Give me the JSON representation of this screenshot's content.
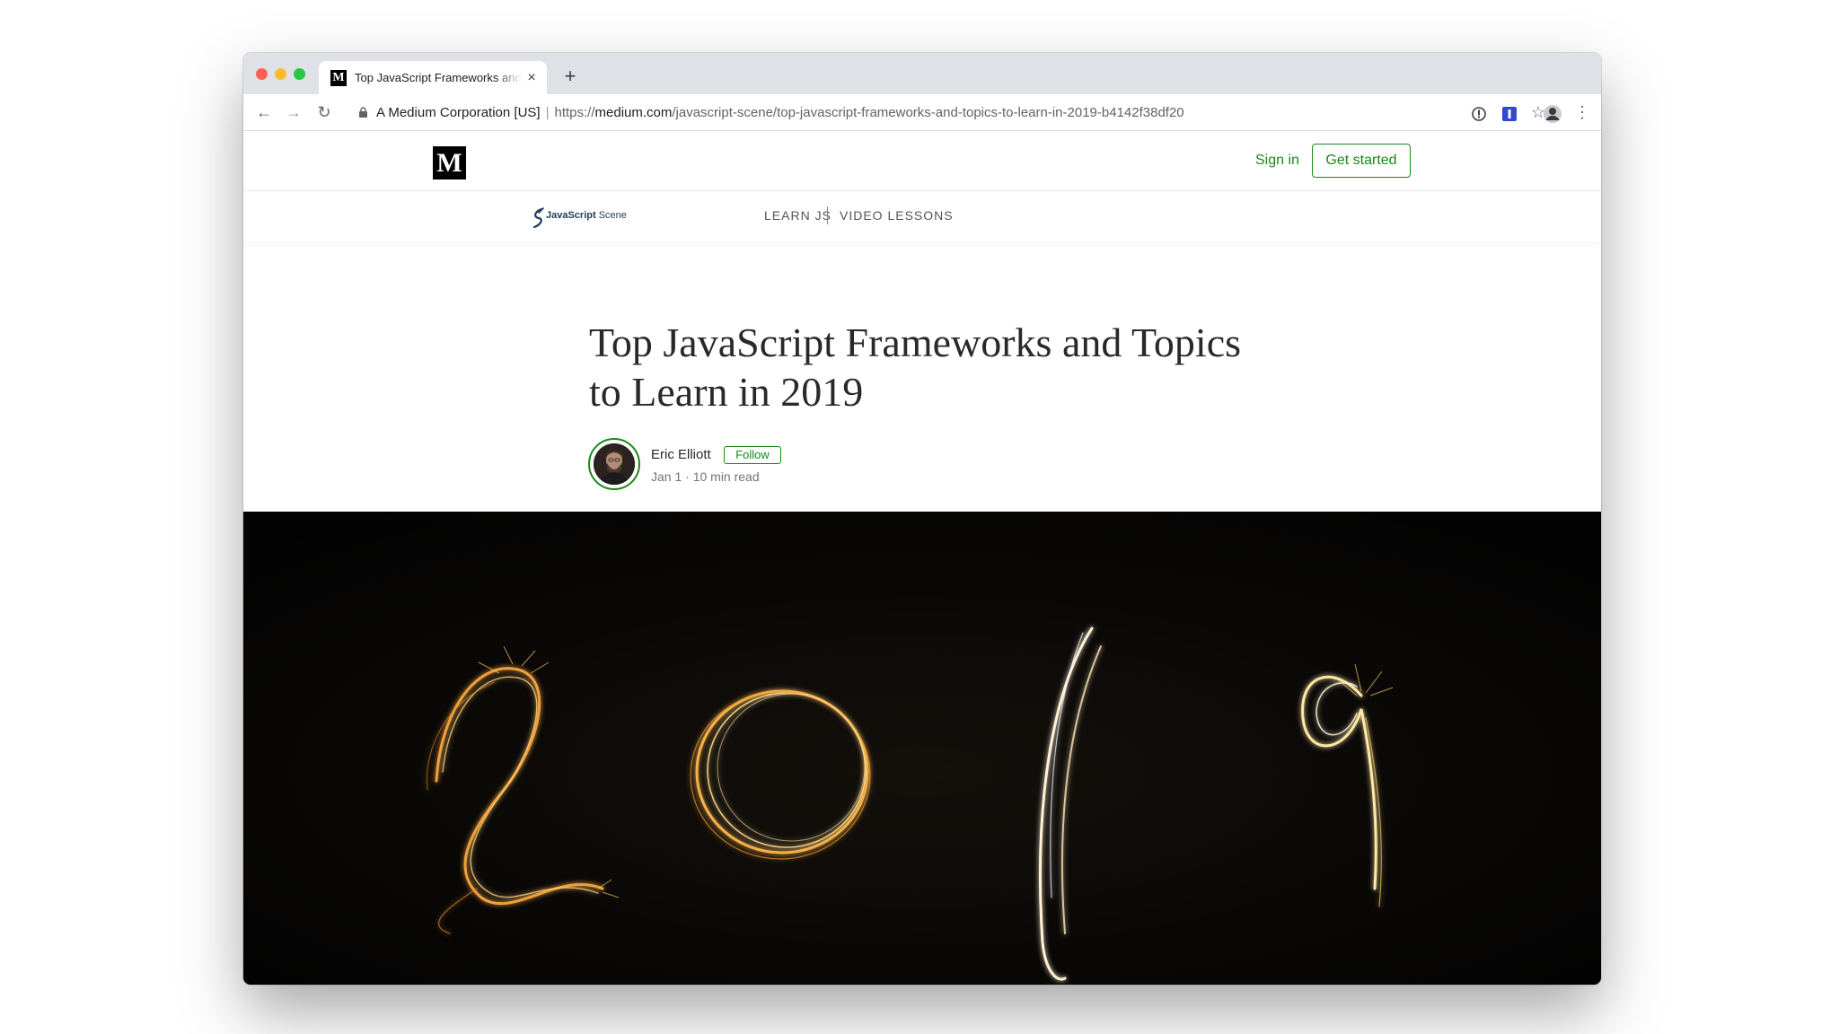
{
  "browser": {
    "tab_title": "Top JavaScript Frameworks and Topics to Learn in 2019",
    "tab_favicon": "M",
    "close_glyph": "×",
    "new_tab_glyph": "+",
    "security_label": "A Medium Corporation [US]",
    "url_scheme": "https://",
    "url_host": "medium.com",
    "url_path": "/javascript-scene/top-javascript-frameworks-and-topics-to-learn-in-2019-b4142f38df20",
    "icons": {
      "back": "←",
      "forward": "→",
      "reload": "↻",
      "star": "☆",
      "menu": "⋮"
    }
  },
  "site_header": {
    "logo_letter": "M",
    "sign_in": "Sign in",
    "get_started": "Get started"
  },
  "publication": {
    "name_bold": "JavaScript",
    "name_light": " Scene",
    "nav": [
      "LEARN JS",
      "VIDEO LESSONS"
    ]
  },
  "article": {
    "title": "Top JavaScript Frameworks and Topics to Learn in 2019",
    "author": "Eric Elliott",
    "follow": "Follow",
    "meta": "Jan 1 · 10 min read",
    "hero_text": "2019"
  },
  "colors": {
    "accent_green": "#1a8917",
    "hero_background": "#050403",
    "sparkle": "#f2a640"
  }
}
